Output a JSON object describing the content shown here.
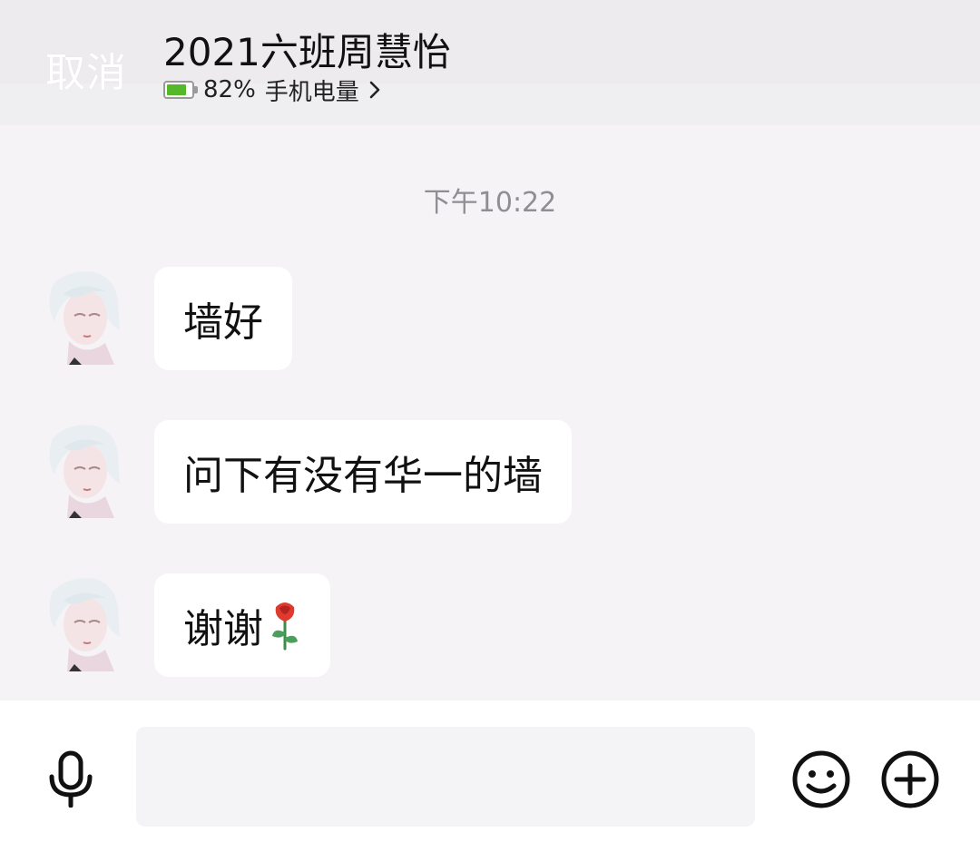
{
  "header": {
    "cancel_label": "取消",
    "title": "2021六班周慧怡",
    "battery_percent_text": "82%",
    "battery_label": "手机电量",
    "battery_level": 0.82,
    "icons": [
      "battery-icon",
      "chevron-right-icon"
    ]
  },
  "chat": {
    "timestamp": "下午10:22",
    "messages": [
      {
        "text": "墙好",
        "emoji": ""
      },
      {
        "text": "问下有没有华一的墙",
        "emoji": ""
      },
      {
        "text": "谢谢",
        "emoji": "rose-emoji"
      }
    ]
  },
  "input_bar": {
    "message_value": "",
    "icons": [
      "microphone-icon",
      "smiley-icon",
      "plus-circle-icon"
    ]
  },
  "colors": {
    "background": "#f5f3f6",
    "header_bg": "#efeef0",
    "bubble_bg": "#ffffff",
    "battery_green": "#55b82a",
    "timestamp_gray": "#8e8e93"
  }
}
